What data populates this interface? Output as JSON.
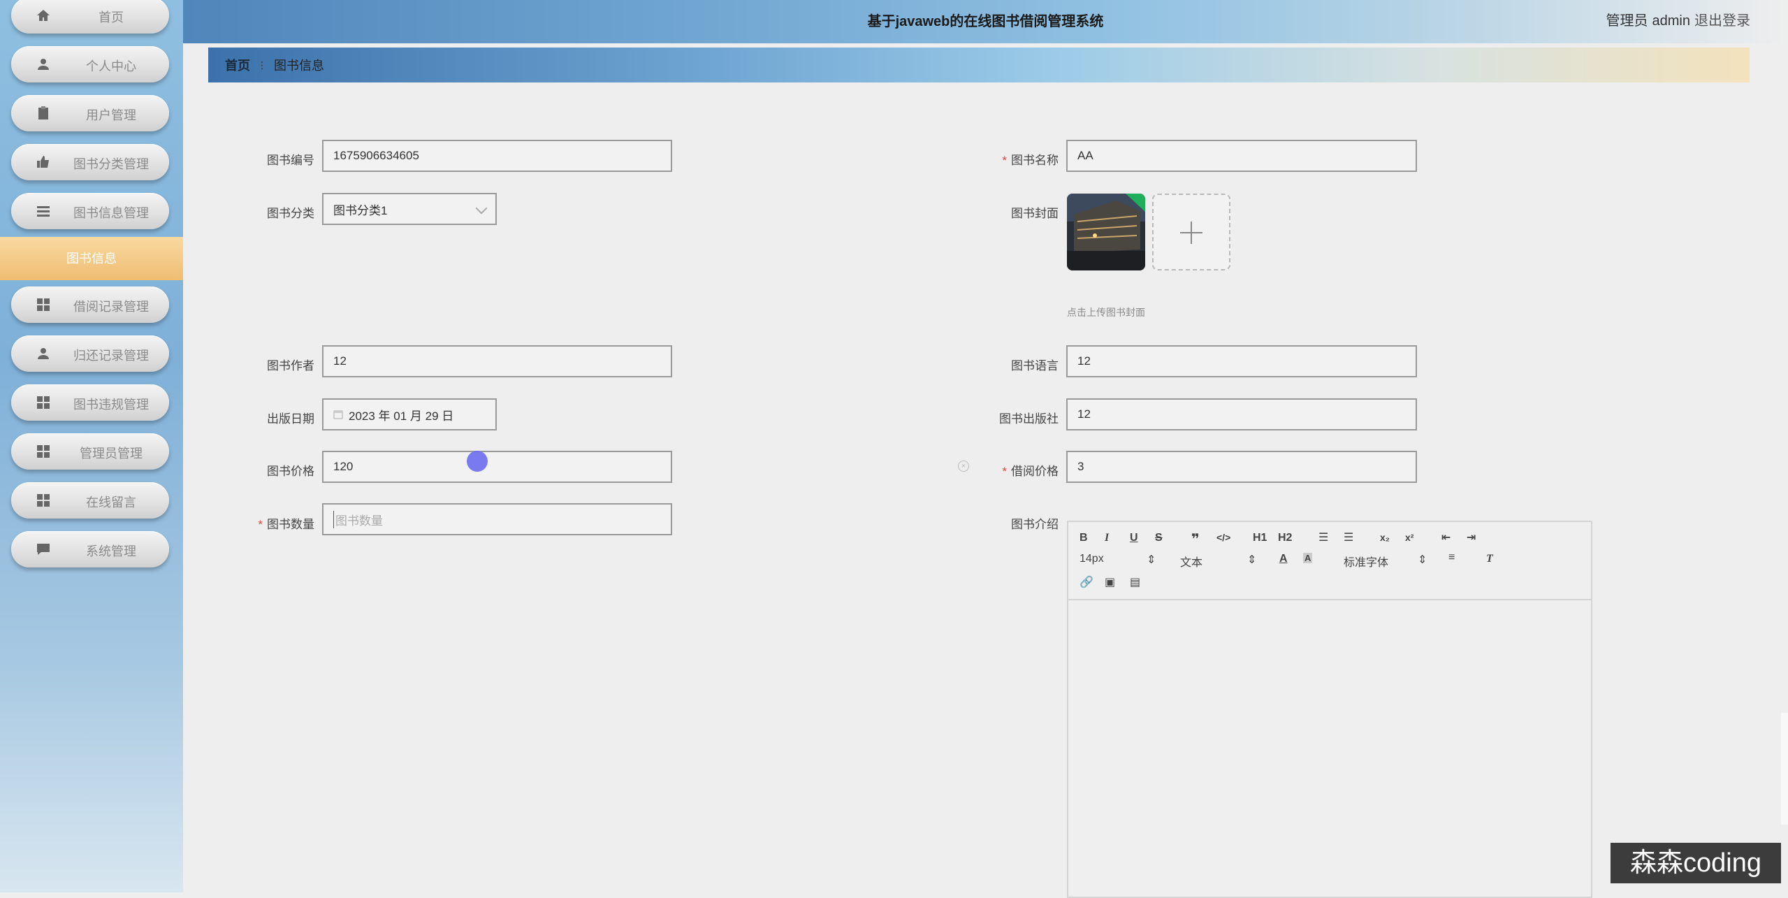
{
  "app": {
    "title": "基于javaweb的在线图书借阅管理系统",
    "user_role": "管理员",
    "user_name": "admin",
    "logout_label": "退出登录"
  },
  "sidebar": {
    "items": [
      {
        "label": "首页",
        "icon": "home-icon"
      },
      {
        "label": "个人中心",
        "icon": "user-icon"
      },
      {
        "label": "用户管理",
        "icon": "clipboard-icon"
      },
      {
        "label": "图书分类管理",
        "icon": "thumbs-up-icon"
      },
      {
        "label": "图书信息管理",
        "icon": "list-icon"
      },
      {
        "label": "借阅记录管理",
        "icon": "grid-icon"
      },
      {
        "label": "归还记录管理",
        "icon": "user-icon"
      },
      {
        "label": "图书违规管理",
        "icon": "grid-icon"
      },
      {
        "label": "管理员管理",
        "icon": "grid-icon"
      },
      {
        "label": "在线留言",
        "icon": "grid-icon"
      },
      {
        "label": "系统管理",
        "icon": "chat-icon"
      }
    ],
    "active_sub_label": "图书信息"
  },
  "breadcrumb": {
    "home": "首页",
    "separator": "⋮",
    "current": "图书信息"
  },
  "form": {
    "book_no_label": "图书编号",
    "book_no_value": "1675906634605",
    "book_name_label": "图书名称",
    "book_name_value": "AA",
    "category_label": "图书分类",
    "category_value": "图书分类1",
    "cover_label": "图书封面",
    "cover_tip": "点击上传图书封面",
    "author_label": "图书作者",
    "author_value": "12",
    "language_label": "图书语言",
    "language_value": "12",
    "pub_date_label": "出版日期",
    "pub_date_value": "2023 年 01 月 29 日",
    "publisher_label": "图书出版社",
    "publisher_value": "12",
    "price_label": "图书价格",
    "price_value": "120",
    "borrow_price_label": "借阅价格",
    "borrow_price_value": "3",
    "quantity_label": "图书数量",
    "quantity_placeholder": "图书数量",
    "intro_label": "图书介绍",
    "required_mark": "*"
  },
  "editor_toolbar": {
    "font_size": "14px",
    "paragraph": "文本",
    "font_family": "标准字体",
    "h1": "H1",
    "h2": "H2",
    "bold": "B",
    "italic": "I",
    "underline": "U",
    "strike": "S"
  },
  "watermark": "森森coding",
  "colors": {
    "accent": "#efbd72",
    "required": "#e0443c",
    "header_start": "#4f86bb"
  }
}
